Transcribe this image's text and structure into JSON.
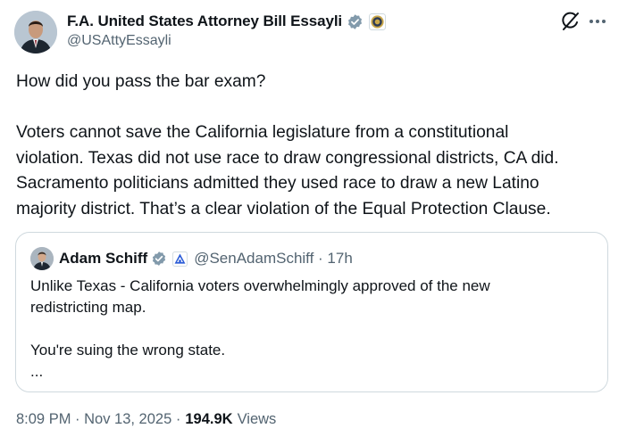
{
  "author": {
    "name": "F.A. United States Attorney Bill Essayli",
    "handle": "@USAttyEssayli"
  },
  "tweet": {
    "line1": "How did you pass the bar exam?",
    "para2_line1": "Voters cannot save the California legislature from a constitutional",
    "para2_line2": "violation. Texas did not use race to draw congressional districts, CA did.",
    "para2_line3": "Sacramento politicians admitted they used race to draw a new Latino",
    "para2_line4": "majority district. That’s a clear violation of the Equal Protection Clause."
  },
  "quote": {
    "name": "Adam Schiff",
    "handle_time": "@SenAdamSchiff · 17h",
    "line1": "Unlike Texas - California voters overwhelmingly approved of the new",
    "line2": "redistricting map.",
    "line3": "You're suing the wrong state.",
    "line4": "..."
  },
  "footer": {
    "timestamp": "8:09 PM · Nov 13, 2025 ·",
    "views_count": "194.9K",
    "views_label": "Views"
  },
  "icons": {
    "verified": "verified-badge-icon",
    "doj_seal": "doj-seal-icon",
    "grok": "grok-icon",
    "more": "more-options-icon",
    "senate": "senate-affiliation-icon"
  },
  "colors": {
    "verified_gray": "#829aab",
    "text_primary": "#0f1419",
    "text_secondary": "#536471",
    "border": "#cfd9de"
  }
}
